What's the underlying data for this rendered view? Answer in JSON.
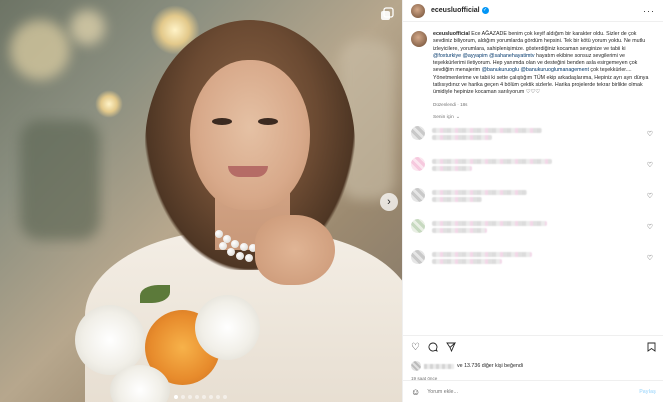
{
  "header": {
    "username": "eceusluofficial",
    "more_icon": "ellipsis-icon"
  },
  "caption": {
    "username": "eceusluofficial",
    "segments": [
      {
        "t": "Ece AĞAZADE benim çok keyif aldığım bir karakter oldu. Sizler de çok sevdiniz biliyorum, aldığım yorumlarda gördüm hepsini. Tek bir kötü yorum yoktu. Ne mutlu izleyicilere, yorumlara, sahiplenişimize. gösterdiğiniz kocaman sevginize ve tabii ki ",
        "link": false
      },
      {
        "t": "@foxturkiye",
        "link": true
      },
      {
        "t": " ",
        "link": false
      },
      {
        "t": "@ayyapim",
        "link": true
      },
      {
        "t": " ",
        "link": false
      },
      {
        "t": "@sahanehayatimtv",
        "link": true
      },
      {
        "t": " hayatım ekibine sonsuz sevgilerimi ve teşekkürlerimi iletiyorum. Hep yanımda olan ve desteğini benden asla esirgemeyen çok sevdiğim menajerim ",
        "link": false
      },
      {
        "t": "@banukuruoglu",
        "link": true
      },
      {
        "t": " ",
        "link": false
      },
      {
        "t": "@banukuruoglumanagement",
        "link": true
      },
      {
        "t": " çok teşekkürler.... Yönetmenlerime ve tabii ki sette çalıştığım TÜM ekip arkadaşlarıma, Hepiniz ayrı ayrı dünya tatlısıydınız ve harika geçen 4 bölüm çektik sizlerle. Harika projelerde tekrar birlikte olmak ümidiyle hepinize kocaman sarılıyorum ♡♡♡",
        "link": false
      }
    ],
    "edited": "Düzenlendi · 18s"
  },
  "senin_icin": "Senin için",
  "comments_count": 5,
  "likes": {
    "text": "ve 13.736 diğer kişi beğendi"
  },
  "time": "19 saat önce",
  "add_comment": {
    "placeholder": "Yorum ekle...",
    "post_label": "Paylaş"
  },
  "icons": {
    "like": "heart-icon",
    "comment": "comment-icon",
    "share": "share-icon",
    "save": "bookmark-icon",
    "emoji": "smile-icon",
    "prev": "chevron-left-icon",
    "next": "chevron-right-icon",
    "multi": "carousel-icon"
  },
  "carousel": {
    "total": 8,
    "active": 0
  }
}
